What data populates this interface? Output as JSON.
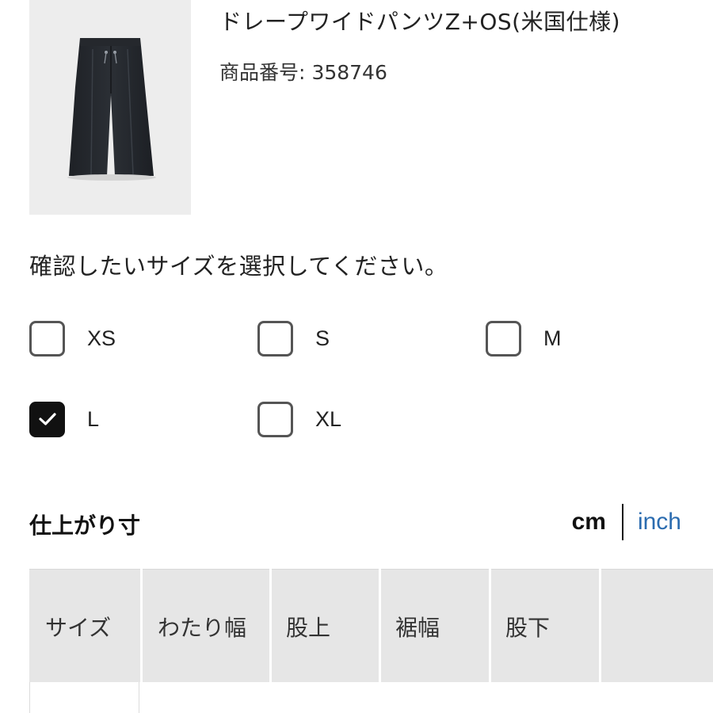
{
  "product": {
    "name": "ドレープワイドパンツZ+OS(米国仕様)",
    "number_label": "商品番号:",
    "number_value": "358746",
    "image_icon": "pants-image"
  },
  "size_select": {
    "prompt": "確認したいサイズを選択してください。",
    "options": [
      {
        "label": "XS",
        "checked": false
      },
      {
        "label": "S",
        "checked": false
      },
      {
        "label": "M",
        "checked": false
      },
      {
        "label": "L",
        "checked": true
      },
      {
        "label": "XL",
        "checked": false
      }
    ]
  },
  "measurements": {
    "title": "仕上がり寸",
    "unit_cm": "cm",
    "unit_inch": "inch",
    "selected_unit": "cm",
    "columns": [
      "サイズ",
      "わたり幅",
      "股上",
      "裾幅",
      "股下",
      ""
    ]
  },
  "colors": {
    "accent_link": "#2b6cb0",
    "checked_box": "#111111",
    "table_header_bg": "#e6e6e6"
  }
}
